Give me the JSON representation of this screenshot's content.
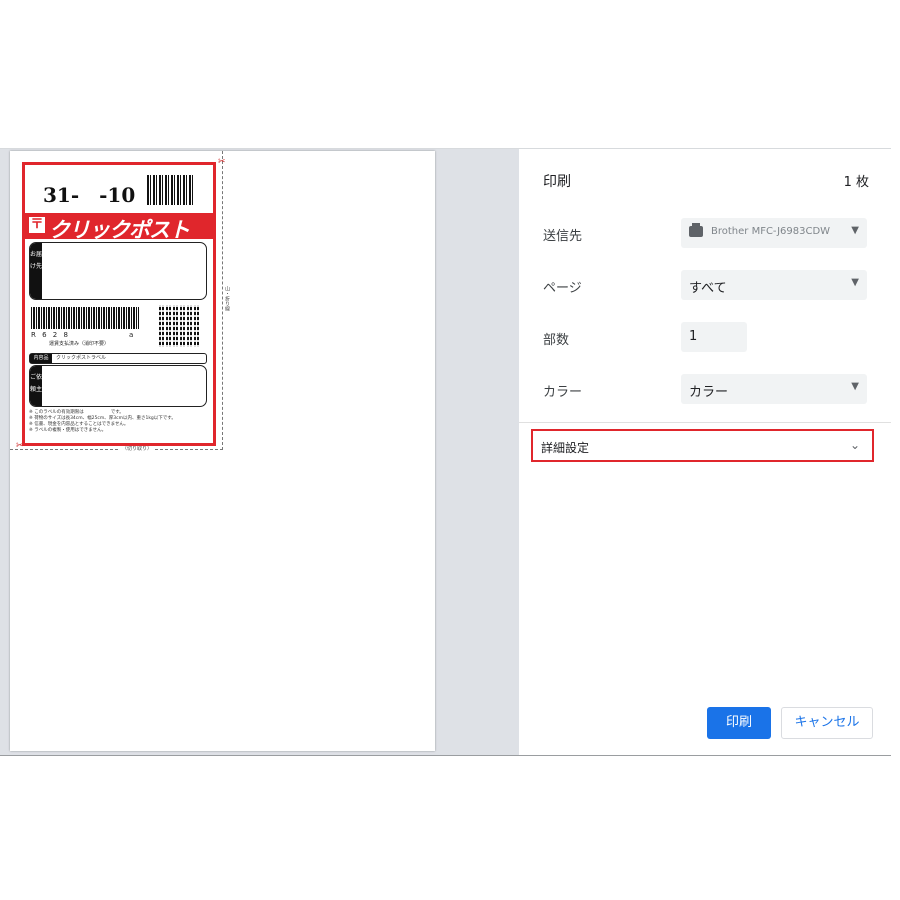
{
  "panel": {
    "title": "印刷",
    "sheet_count": "1 枚",
    "destination_label": "送信先",
    "destination_value": "Brother MFC-J6983CDW",
    "pages_label": "ページ",
    "pages_value": "すべて",
    "copies_label": "部数",
    "copies_value": "1",
    "color_label": "カラー",
    "color_value": "カラー",
    "advanced_label": "詳細設定",
    "print_button": "印刷",
    "cancel_button": "キャンセル"
  },
  "label": {
    "ticket_number": "31-　-10",
    "brand": "クリックポスト",
    "brand_mark": "〒",
    "recipient_tab": "お届け先",
    "sender_tab": "ご依頼主",
    "code_left": "R 6 2 8",
    "code_right": "a",
    "paid_text": "運賃支払済み（消印不要）",
    "contents_tab": "内容品",
    "contents_value": "クリックポストラベル",
    "notes": "※ このラベルの有効期限は　　　　　　です。\n※ 荷物のサイズは長34cm、幅25cm、厚3cm以内、重さ1kg以下です。\n※ 信書、現金を内容品とすることはできません。\n※ ラベルの複製・使用はできません。",
    "cut_right": "山・折り線",
    "cut_bottom": "（切り取り）"
  },
  "colors": {
    "accent": "#1a73e8",
    "highlight": "#e0262c",
    "brand_red": "#e0262c"
  }
}
